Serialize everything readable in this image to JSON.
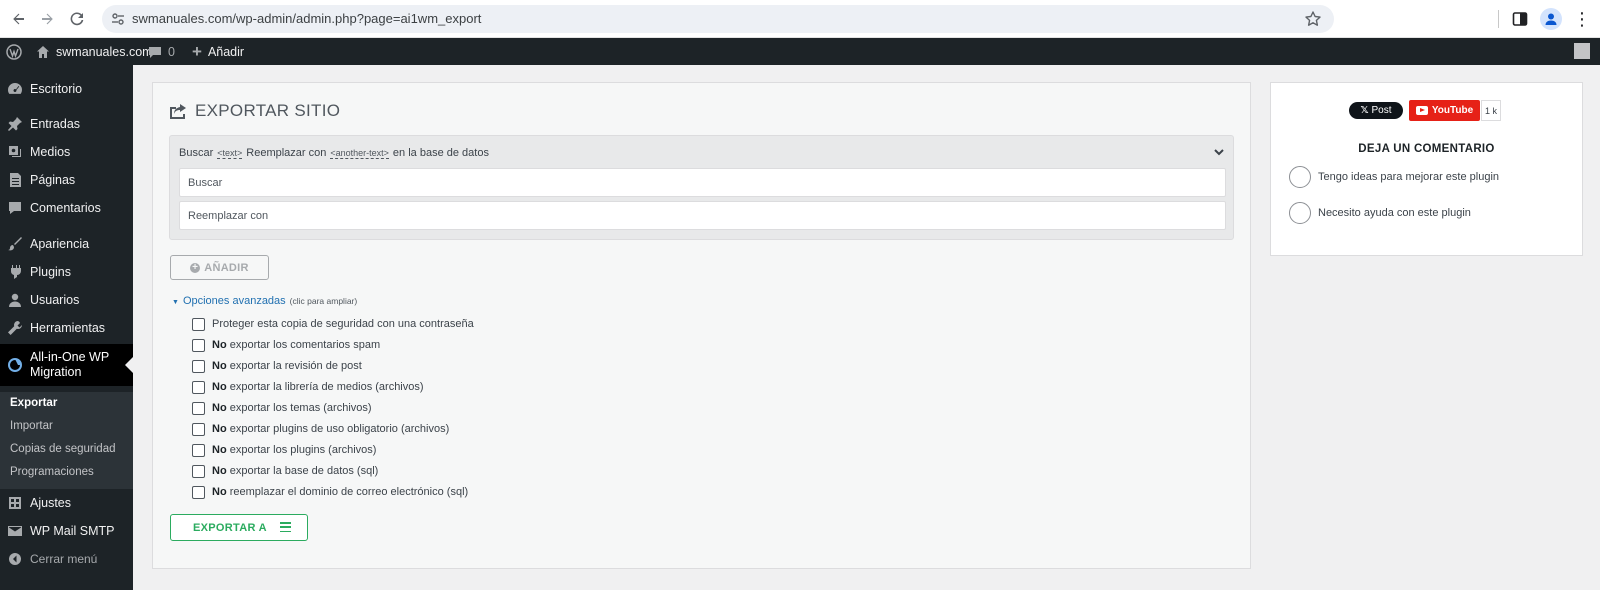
{
  "browser": {
    "url": "swmanuales.com/wp-admin/admin.php?page=ai1wm_export"
  },
  "adminbar": {
    "site_name": "swmanuales.com",
    "comments_count": "0",
    "new_label": "Añadir"
  },
  "sidebar": {
    "items": [
      {
        "label": "Escritorio",
        "icon": "dashboard-icon"
      },
      {
        "label": "Entradas",
        "icon": "pin-icon"
      },
      {
        "label": "Medios",
        "icon": "media-icon"
      },
      {
        "label": "Páginas",
        "icon": "page-icon"
      },
      {
        "label": "Comentarios",
        "icon": "comment-icon"
      },
      {
        "label": "Apariencia",
        "icon": "brush-icon"
      },
      {
        "label": "Plugins",
        "icon": "plugin-icon"
      },
      {
        "label": "Usuarios",
        "icon": "user-icon"
      },
      {
        "label": "Herramientas",
        "icon": "wrench-icon"
      },
      {
        "label": "All-in-One WP Migration",
        "icon": "migration-icon"
      },
      {
        "label": "Ajustes",
        "icon": "settings-icon"
      },
      {
        "label": "WP Mail SMTP",
        "icon": "mail-icon"
      }
    ],
    "submenu": [
      "Exportar",
      "Importar",
      "Copias de seguridad",
      "Programaciones"
    ],
    "collapse_label": "Cerrar menú"
  },
  "main": {
    "title": "EXPORTAR SITIO",
    "search_replace": {
      "header_prefix": "Buscar",
      "tag_text": "<text>",
      "header_middle": "Reemplazar con",
      "tag_another": "<another-text>",
      "header_suffix": "en la base de datos",
      "search_placeholder": "Buscar",
      "replace_placeholder": "Reemplazar con"
    },
    "add_button": "AÑADIR",
    "advanced_label": "Opciones avanzadas",
    "advanced_note": "(clic para ampliar)",
    "options": [
      {
        "prefix": "",
        "text": "Proteger esta copia de seguridad con una contraseña"
      },
      {
        "prefix": "No",
        "text": "exportar los comentarios spam"
      },
      {
        "prefix": "No",
        "text": "exportar la revisión de post"
      },
      {
        "prefix": "No",
        "text": "exportar la librería de medios (archivos)"
      },
      {
        "prefix": "No",
        "text": "exportar los temas (archivos)"
      },
      {
        "prefix": "No",
        "text": "exportar plugins de uso obligatorio (archivos)"
      },
      {
        "prefix": "No",
        "text": "exportar los plugins (archivos)"
      },
      {
        "prefix": "No",
        "text": "exportar la base de datos (sql)"
      },
      {
        "prefix": "No",
        "text": "reemplazar el dominio de correo electrónico (sql)"
      }
    ],
    "export_button": "EXPORTAR A"
  },
  "side": {
    "x_post": "Post",
    "youtube": "YouTube",
    "youtube_count": "1 k",
    "feedback_title": "DEJA UN COMENTARIO",
    "feedback_options": [
      "Tengo ideas para mejorar este plugin",
      "Necesito ayuda con este plugin"
    ]
  },
  "colors": {
    "admin_bar": "#1d2327",
    "export_green": "#2bab5f",
    "link_blue": "#2271b1",
    "youtube_red": "#e62117"
  }
}
